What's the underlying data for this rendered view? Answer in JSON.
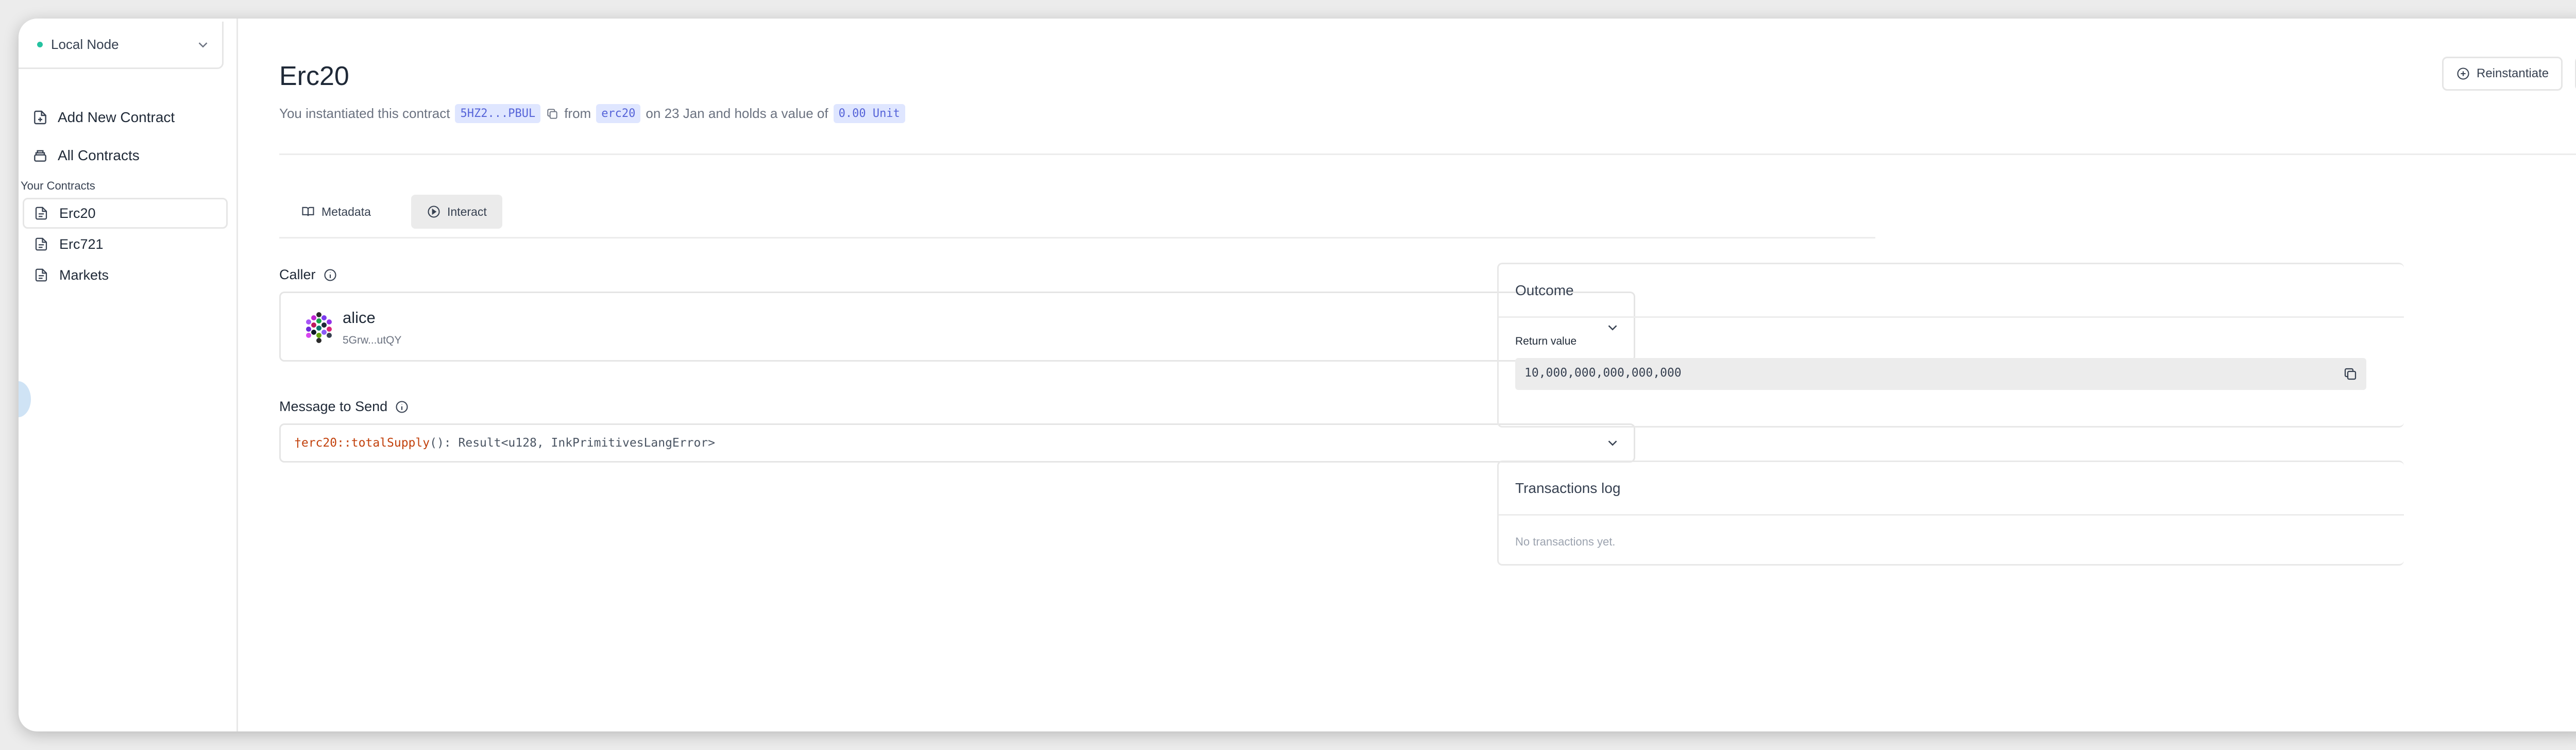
{
  "sidebar": {
    "node": {
      "label": "Local Node",
      "status_color": "#25c2a0"
    },
    "add_contract": "Add New Contract",
    "all_contracts": "All Contracts",
    "section_title": "Your Contracts",
    "contracts": [
      {
        "label": "Erc20",
        "active": true
      },
      {
        "label": "Erc721",
        "active": false
      },
      {
        "label": "Markets",
        "active": false
      }
    ]
  },
  "header": {
    "title": "Erc20",
    "sub_prefix": "You instantiated this contract",
    "address": "5HZ2...PBUL",
    "from_word": "from",
    "code_name": "erc20",
    "date_text": "on 23 Jan and holds a value of",
    "value": "0.00 Unit",
    "reinstantiate": "Reinstantiate"
  },
  "tabs": [
    {
      "label": "Metadata",
      "icon": "book-icon",
      "active": false
    },
    {
      "label": "Interact",
      "icon": "play-circle-icon",
      "active": true
    }
  ],
  "caller": {
    "label": "Caller",
    "name": "alice",
    "address": "5Grw...utQY"
  },
  "message": {
    "label": "Message to Send",
    "fn": "†erc20::totalSupply",
    "rest": "(): Result<u128, InkPrimitivesLangError>"
  },
  "outcome": {
    "title": "Outcome",
    "return_label": "Return value",
    "return_value": "10,000,000,000,000,000"
  },
  "txlog": {
    "title": "Transactions log",
    "empty": "No transactions yet."
  },
  "colors": {
    "accent_pill_bg": "#dfe6ff",
    "accent_pill_text": "#5563d8",
    "fn_color": "#c2410c"
  }
}
